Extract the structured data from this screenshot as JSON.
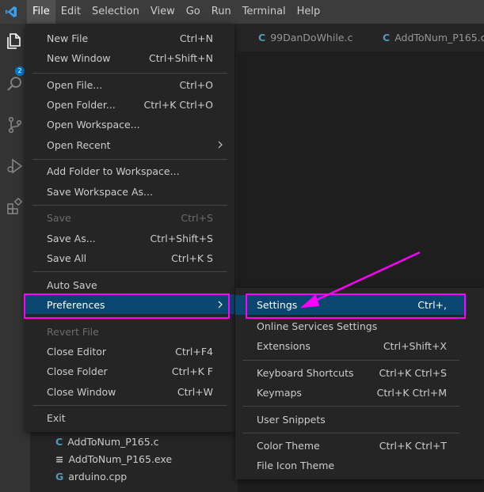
{
  "menubar": [
    "File",
    "Edit",
    "Selection",
    "View",
    "Go",
    "Run",
    "Terminal",
    "Help"
  ],
  "activity": {
    "badge": "2"
  },
  "tabs": [
    "99DanDoWhile.c",
    "AddToNum_P165.c"
  ],
  "tab_icon_letter": "C",
  "explorer_files": [
    {
      "icon": "C",
      "name": "AddToNum_P165.c"
    },
    {
      "icon": "≡",
      "name": "AddToNum_P165.exe"
    },
    {
      "icon": "G",
      "name": "arduino.cpp"
    }
  ],
  "file_menu": [
    {
      "label": "New File",
      "shortcut": "Ctrl+N"
    },
    {
      "label": "New Window",
      "shortcut": "Ctrl+Shift+N"
    },
    {
      "label": "Open File...",
      "shortcut": "Ctrl+O"
    },
    {
      "label": "Open Folder...",
      "shortcut": "Ctrl+K Ctrl+O"
    },
    {
      "label": "Open Workspace...",
      "shortcut": ""
    },
    {
      "label": "Open Recent",
      "shortcut": ""
    },
    {
      "label": "Add Folder to Workspace...",
      "shortcut": ""
    },
    {
      "label": "Save Workspace As...",
      "shortcut": ""
    },
    {
      "label": "Save",
      "shortcut": "Ctrl+S"
    },
    {
      "label": "Save As...",
      "shortcut": "Ctrl+Shift+S"
    },
    {
      "label": "Save All",
      "shortcut": "Ctrl+K S"
    },
    {
      "label": "Auto Save",
      "shortcut": ""
    },
    {
      "label": "Preferences",
      "shortcut": ""
    },
    {
      "label": "Revert File",
      "shortcut": ""
    },
    {
      "label": "Close Editor",
      "shortcut": "Ctrl+F4"
    },
    {
      "label": "Close Folder",
      "shortcut": "Ctrl+K F"
    },
    {
      "label": "Close Window",
      "shortcut": "Ctrl+W"
    },
    {
      "label": "Exit",
      "shortcut": ""
    }
  ],
  "preferences_menu": [
    {
      "label": "Settings",
      "shortcut": "Ctrl+,"
    },
    {
      "label": "Online Services Settings",
      "shortcut": ""
    },
    {
      "label": "Extensions",
      "shortcut": "Ctrl+Shift+X"
    },
    {
      "label": "Keyboard Shortcuts",
      "shortcut": "Ctrl+K Ctrl+S"
    },
    {
      "label": "Keymaps",
      "shortcut": "Ctrl+K Ctrl+M"
    },
    {
      "label": "User Snippets",
      "shortcut": ""
    },
    {
      "label": "Color Theme",
      "shortcut": "Ctrl+K Ctrl+T"
    },
    {
      "label": "File Icon Theme",
      "shortcut": ""
    }
  ],
  "colors": {
    "highlight": "#094771",
    "annotation": "#ff00ff",
    "accent": "#007acc"
  }
}
